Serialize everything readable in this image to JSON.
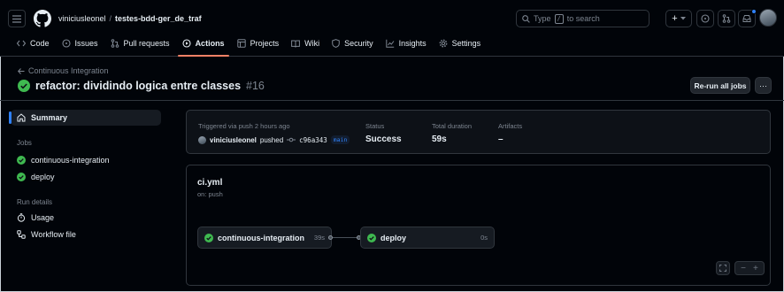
{
  "header": {
    "owner": "viniciusleonel",
    "separator": "/",
    "repo": "testes-bdd-ger_de_traf",
    "search_placeholder": "Type / to search",
    "search_prefix": "Type",
    "search_key": "/",
    "search_suffix": "to search",
    "plus_label": "+",
    "notification_color": "#2f81f7"
  },
  "tabs": [
    {
      "label": "Code",
      "icon": "code-icon"
    },
    {
      "label": "Issues",
      "icon": "issue-icon"
    },
    {
      "label": "Pull requests",
      "icon": "pull-request-icon"
    },
    {
      "label": "Actions",
      "icon": "play-icon",
      "active": true
    },
    {
      "label": "Projects",
      "icon": "table-icon"
    },
    {
      "label": "Wiki",
      "icon": "book-icon"
    },
    {
      "label": "Security",
      "icon": "shield-icon"
    },
    {
      "label": "Insights",
      "icon": "graph-icon"
    },
    {
      "label": "Settings",
      "icon": "gear-icon"
    }
  ],
  "run": {
    "back_label": "Continuous Integration",
    "title": "refactor: dividindo logica entre classes",
    "number": "#16",
    "rerun_label": "Re-run all jobs",
    "more_label": "···",
    "success_color": "#3fb950"
  },
  "sidebar": {
    "summary_label": "Summary",
    "jobs_heading": "Jobs",
    "jobs": [
      "continuous-integration",
      "deploy"
    ],
    "run_details_heading": "Run details",
    "usage_label": "Usage",
    "workflow_file_label": "Workflow file"
  },
  "summary": {
    "trigger": "Triggered via push 2 hours ago",
    "actor": "viniciusleonel",
    "action": "pushed",
    "commit": "c96a343",
    "branch": "main",
    "status_label": "Status",
    "status_value": "Success",
    "duration_label": "Total duration",
    "duration_value": "59s",
    "artifacts_label": "Artifacts",
    "artifacts_value": "–"
  },
  "graph": {
    "workflow_file": "ci.yml",
    "trigger": "on: push",
    "jobs": [
      {
        "name": "continuous-integration",
        "duration": "39s"
      },
      {
        "name": "deploy",
        "duration": "0s"
      }
    ],
    "zoom_minus": "−",
    "zoom_plus": "+"
  }
}
